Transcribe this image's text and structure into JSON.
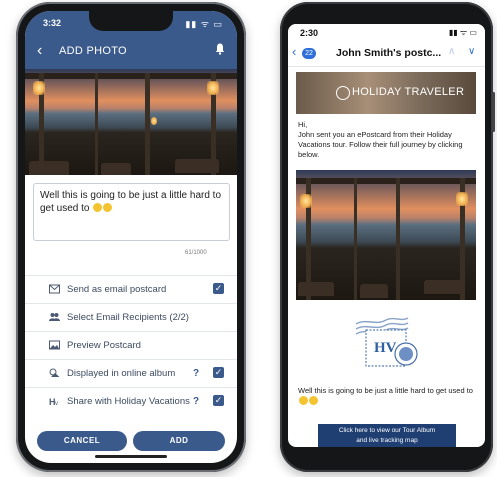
{
  "left_phone": {
    "status": {
      "time": "3:32",
      "icons": "▮▮ ᯤ ▭"
    },
    "header": {
      "back_glyph": "‹",
      "title": "ADD PHOTO"
    },
    "message_text": "Well this is going to be just a little hard to get used to",
    "char_counter": "61/1000",
    "options": [
      {
        "label": "Send as email postcard",
        "icon": "postcard-icon",
        "checked": true,
        "help": ""
      },
      {
        "label": "Select Email Recipients (2/2)",
        "icon": "people-icon",
        "checked": false,
        "help": ""
      },
      {
        "label": "Preview Postcard",
        "icon": "image-icon",
        "checked": false,
        "help": ""
      },
      {
        "label": "Displayed in online album",
        "icon": "album-icon",
        "checked": true,
        "help": "?"
      },
      {
        "label": "Share with Holiday Vacations",
        "icon": "share-logo-icon",
        "checked": true,
        "help": "?"
      }
    ],
    "buttons": {
      "cancel": "CANCEL",
      "add": "ADD"
    },
    "accent_color": "#3a5a8c"
  },
  "right_phone": {
    "status": {
      "time": "2:30",
      "icons": "▮▮ ᯤ ▭"
    },
    "mail": {
      "unread_badge": "22",
      "subject": "John Smith's postc...",
      "banner_title": "HOLIDAY TRAVELER",
      "greeting": "Hi,",
      "intro": "John sent you an ePostcard from their Holiday Vacations tour. Follow their full journey by clicking below.",
      "stamp_text": "HV",
      "caption": "Well this is going to be just a little hard to get used to",
      "cta_line1": "Click here to view our Tour Album",
      "cta_line2": "and live tracking map"
    },
    "accent_color": "#1f3f73"
  }
}
